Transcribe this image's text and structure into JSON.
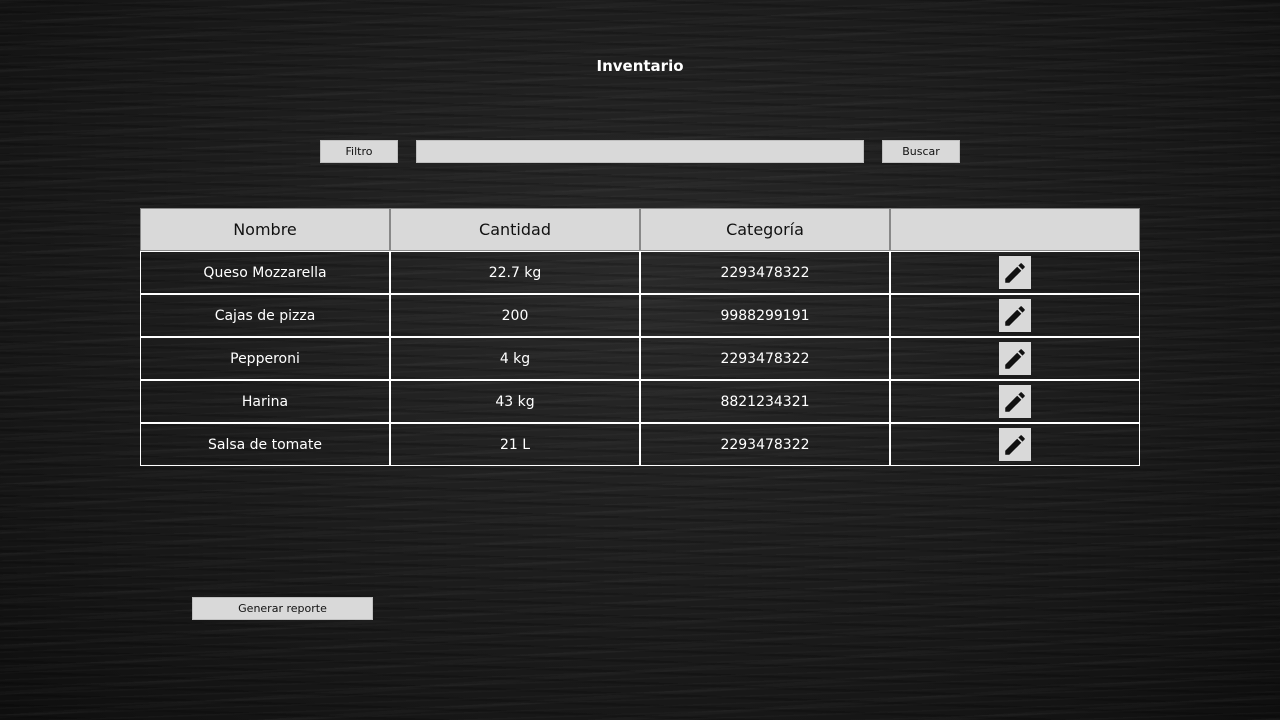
{
  "page": {
    "title": "Inventario"
  },
  "toolbar": {
    "filter_label": "Filtro",
    "search_value": "",
    "search_placeholder": "",
    "search_label": "Buscar"
  },
  "table": {
    "headers": [
      "Nombre",
      "Cantidad",
      "Categoría",
      ""
    ],
    "rows": [
      {
        "nombre": "Queso Mozzarella",
        "cantidad": "22.7 kg",
        "categoria": "2293478322"
      },
      {
        "nombre": "Cajas de pizza",
        "cantidad": "200",
        "categoria": "9988299191"
      },
      {
        "nombre": "Pepperoni",
        "cantidad": "4 kg",
        "categoria": "2293478322"
      },
      {
        "nombre": "Harina",
        "cantidad": "43 kg",
        "categoria": "8821234321"
      },
      {
        "nombre": "Salsa de tomate",
        "cantidad": "21 L",
        "categoria": "2293478322"
      }
    ],
    "row_action_icon": "pencil-icon"
  },
  "footer": {
    "report_label": "Generar reporte"
  },
  "colors": {
    "background": "#1a1a1a",
    "control_fill": "#d9d9d9",
    "table_border": "#ffffff",
    "text": "#ffffff"
  }
}
